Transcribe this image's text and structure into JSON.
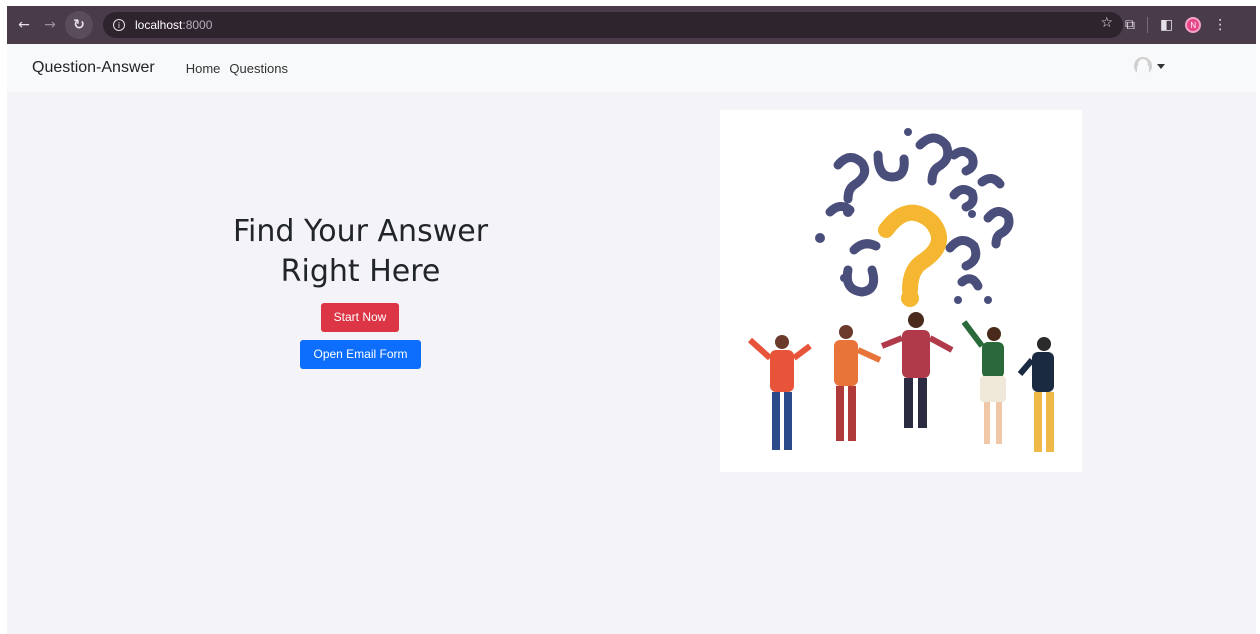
{
  "browser": {
    "url_host": "localhost",
    "url_port": ":8000",
    "profile_initial": "N"
  },
  "navbar": {
    "brand": "Question-Answer",
    "links": [
      {
        "label": "Home"
      },
      {
        "label": "Questions"
      }
    ]
  },
  "hero": {
    "title_line1": "Find Your Answer",
    "title_line2": "Right Here",
    "start_button": "Start Now",
    "email_button": "Open Email Form"
  },
  "colors": {
    "start_button": "#dc3545",
    "email_button": "#0d6efd",
    "question_mark_accent": "#f5b731",
    "question_mark_main": "#4a4e7a"
  }
}
